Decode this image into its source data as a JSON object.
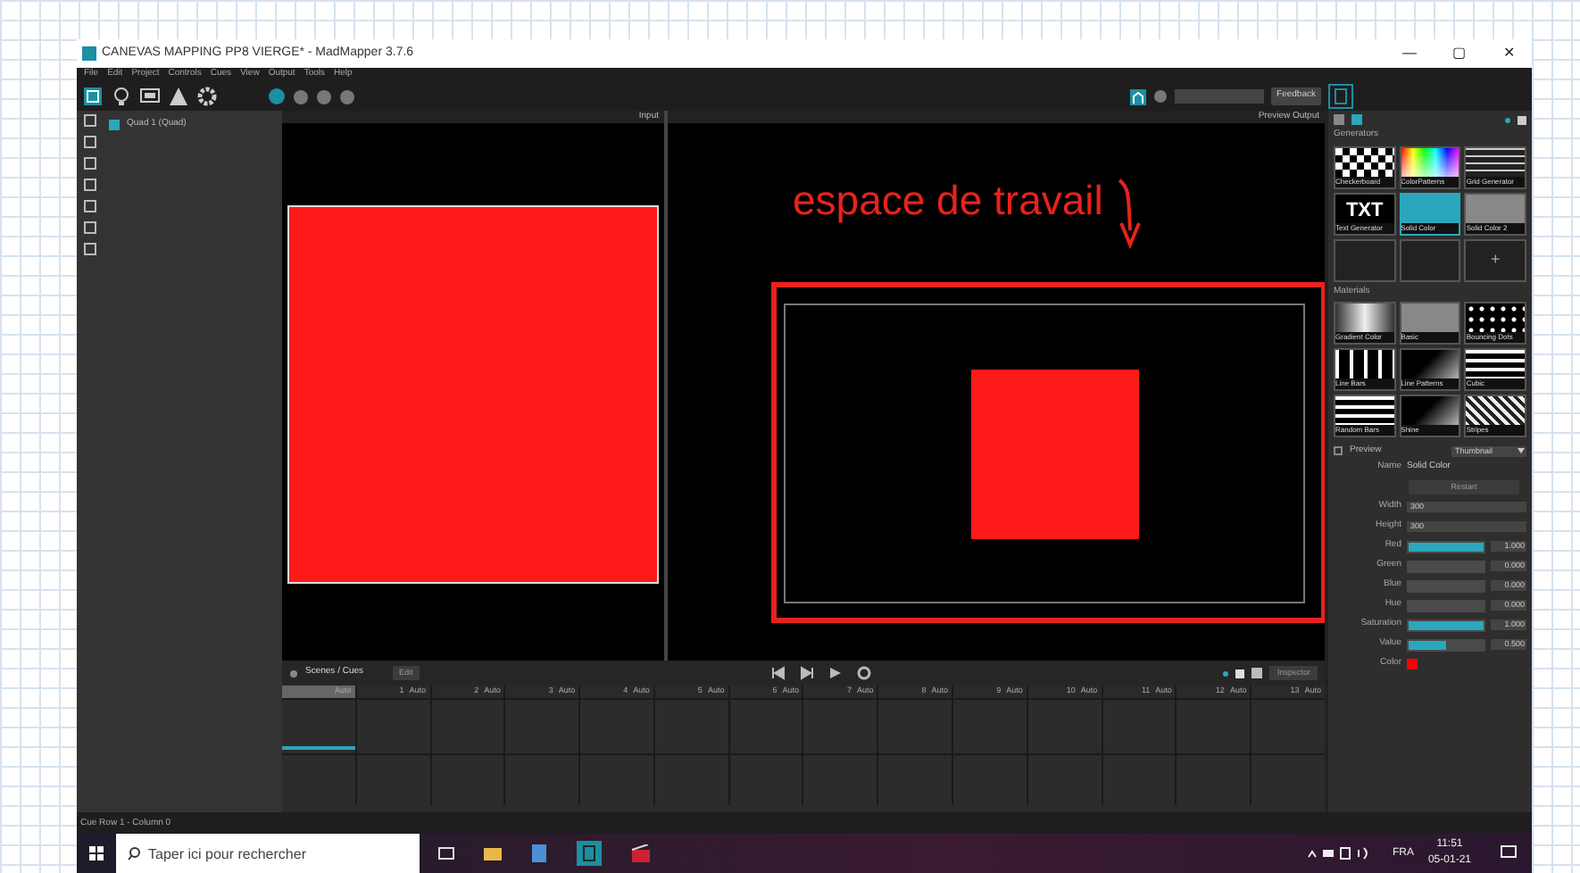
{
  "window": {
    "title": "CANEVAS MAPPING PP8 VIERGE* - MadMapper 3.7.6",
    "controls": [
      "—",
      "▢",
      "✕"
    ]
  },
  "menu": [
    "File",
    "Edit",
    "Project",
    "Controls",
    "Cues",
    "View",
    "Output",
    "Tools",
    "Help"
  ],
  "toolbar": {
    "feedback_button": "Feedback"
  },
  "left_panel": {
    "surface": {
      "name": "Quad 1 (Quad)",
      "visible": true
    }
  },
  "input_view": {
    "label": "Input"
  },
  "output_view": {
    "label": "Preview Output",
    "annotation": "espace de travail"
  },
  "generators": {
    "title": "Generators",
    "tiles": [
      {
        "label": "Checkerboard",
        "kind": "checker",
        "selected": false
      },
      {
        "label": "ColorPatterns",
        "kind": "spectrum",
        "selected": false
      },
      {
        "label": "Grid Generator",
        "kind": "grid",
        "selected": false
      },
      {
        "label": "Text Generator",
        "kind": "text",
        "text": "TXT",
        "selected": false
      },
      {
        "label": "Solid Color",
        "kind": "solid",
        "selected": true
      },
      {
        "label": "Solid Color 2",
        "kind": "plain",
        "selected": false
      }
    ],
    "add": "+"
  },
  "materials": {
    "title": "Materials",
    "tiles": [
      {
        "label": "Gradient Color",
        "kind": "gradient"
      },
      {
        "label": "Basic",
        "kind": "plain"
      },
      {
        "label": "Bouncing Dots",
        "kind": "dots"
      },
      {
        "label": "Line Bars",
        "kind": "bars"
      },
      {
        "label": "Line Patterns",
        "kind": "fade"
      },
      {
        "label": "Cubic",
        "kind": "blocks"
      },
      {
        "label": "Random Bars",
        "kind": "blocks"
      },
      {
        "label": "Shine",
        "kind": "fade"
      },
      {
        "label": "Stripes",
        "kind": "stripes"
      }
    ]
  },
  "properties": {
    "preview": {
      "label": "Preview",
      "checked": false
    },
    "preview_mode": "Thumbnail",
    "rows": [
      {
        "kind": "name",
        "label": "Name",
        "value": "Solid Color"
      },
      {
        "kind": "button",
        "value": "Restart"
      },
      {
        "kind": "field",
        "label": "Width",
        "value": "300"
      },
      {
        "kind": "field",
        "label": "Height",
        "value": "300"
      },
      {
        "kind": "slider",
        "label": "Red",
        "value": "1.000",
        "level": 1
      },
      {
        "kind": "slider",
        "label": "Green",
        "value": "0.000",
        "level": 0
      },
      {
        "kind": "slider",
        "label": "Blue",
        "value": "0.000",
        "level": 0
      },
      {
        "kind": "slider",
        "label": "Hue",
        "value": "0.000",
        "level": 0
      },
      {
        "kind": "slider",
        "label": "Saturation",
        "value": "1.000",
        "level": 1
      },
      {
        "kind": "slider",
        "label": "Value",
        "value": "0.500",
        "level": 0.5
      },
      {
        "kind": "swatch",
        "label": "Color",
        "color": "#ff0000"
      }
    ]
  },
  "timeline": {
    "title": "Scenes / Cues",
    "edit_button": "Edit",
    "inspector_button": "Inspector",
    "columns": [
      {
        "mode": "Auto",
        "selected": true
      },
      {
        "number": "1",
        "mode": "Auto",
        "selected": false
      },
      {
        "number": "2",
        "mode": "Auto",
        "selected": false
      },
      {
        "number": "3",
        "mode": "Auto",
        "selected": false
      },
      {
        "number": "4",
        "mode": "Auto",
        "selected": false
      },
      {
        "number": "5",
        "mode": "Auto",
        "selected": false
      },
      {
        "number": "6",
        "mode": "Auto",
        "selected": false
      },
      {
        "number": "7",
        "mode": "Auto",
        "selected": false
      },
      {
        "number": "8",
        "mode": "Auto",
        "selected": false
      },
      {
        "number": "9",
        "mode": "Auto",
        "selected": false
      },
      {
        "number": "10",
        "mode": "Auto",
        "selected": false
      },
      {
        "number": "11",
        "mode": "Auto",
        "selected": false
      },
      {
        "number": "12",
        "mode": "Auto",
        "selected": false
      },
      {
        "number": "13",
        "mode": "Auto",
        "selected": false
      }
    ]
  },
  "status_bar": "Cue Row 1 - Column 0",
  "taskbar": {
    "search": {
      "placeholder": "Taper ici pour rechercher"
    },
    "language": "FRA",
    "time": "11:51",
    "date": "05-01-21"
  }
}
